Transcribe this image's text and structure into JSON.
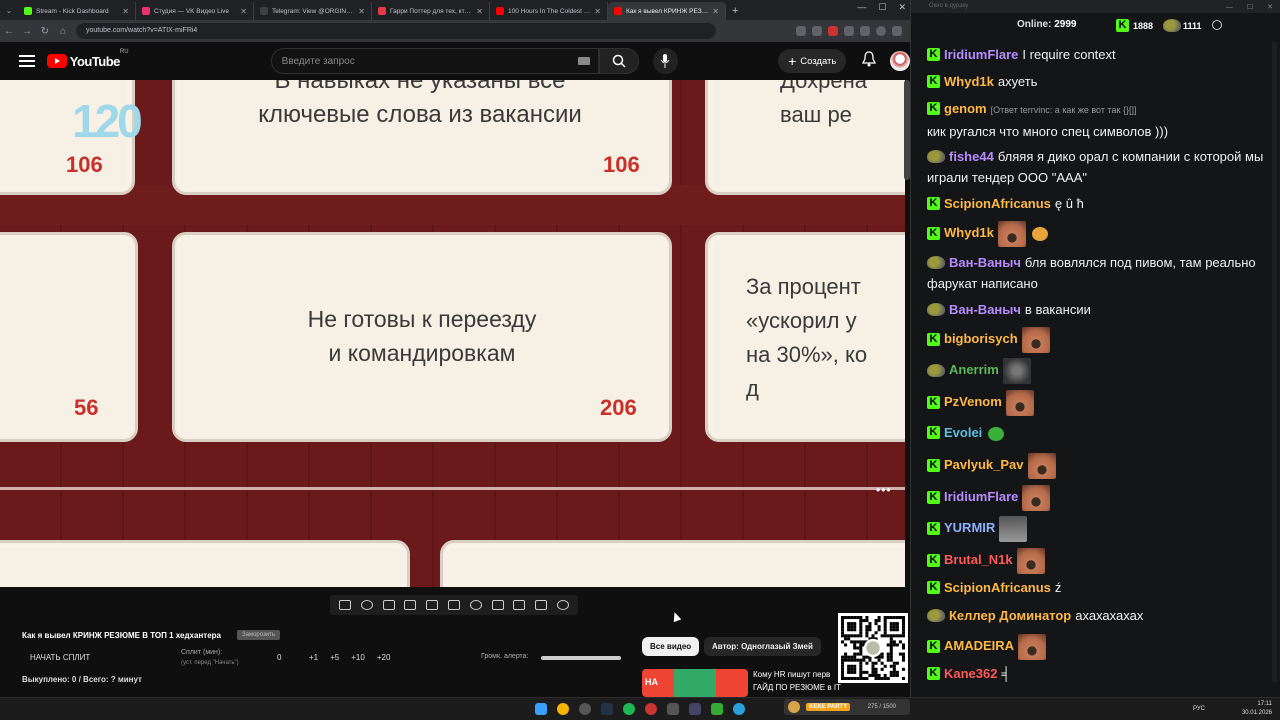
{
  "browser": {
    "tabs": [
      {
        "label": "Stream - Kick Dashboard",
        "color": "#53fc18"
      },
      {
        "label": "Студия — VK Видео Live",
        "color": "#e8326e"
      },
      {
        "label": "Telegram: View @ORGINALDA...",
        "color": "#3c4043"
      },
      {
        "label": "Гарри Поттер для тех, кто вы...",
        "color": "#e63946"
      },
      {
        "label": "100 Hours In The Coldest City",
        "color": "#ff0000"
      },
      {
        "label": "Как я вывел КРИНЖ РЕЗЮ...",
        "color": "#ff0000"
      }
    ],
    "active_tab": 5,
    "url": "youtube.com/watch?v=ATIX-miFRi4"
  },
  "youtube": {
    "logo_word": "YouTube",
    "country": "RU",
    "search_placeholder": "Введите запрос",
    "create_label": "Создать"
  },
  "video": {
    "timer": "120",
    "cards": [
      {
        "text": "В навыках не указаны все\nключевые слова из вакансии",
        "points": "106",
        "left_points": "106"
      },
      {
        "text": "Не готовы к переезду\nи командировкам",
        "points": "206",
        "left_points": "56"
      },
      {
        "text_right_top": "Дохрена\nваш ре",
        "text_right_mid": "За процент\n«ускорил у\nна 30%», ко\nд"
      }
    ]
  },
  "below": {
    "video_title": "Как я вывел КРИНЖ РЕЗЮМЕ В ТОП 1 хедхантера",
    "tag_button": "Заморозить",
    "split_button": "НАЧАТЬ СПЛИТ",
    "split_label": "Сплит (мин):",
    "split_hint": "(уст. перед \"Начать\")",
    "split_value": "0",
    "increments": [
      "+1",
      "+5",
      "+10",
      "+20"
    ],
    "bought": "Выкуплено: 0 / Всего: ? минут",
    "alert_label": "Громк. алерта:",
    "chip_all": "Все видео",
    "chip_author": "Автор: Одноглазый Змей",
    "rec_line1": "Кому HR пишут перв",
    "rec_line2": "ГАЙД ПО РЕЗЮМЕ в IT",
    "thumb_text": "НА"
  },
  "chat": {
    "window_title": "Окно в дураку",
    "online_label": "Online:",
    "online_count": "2999",
    "kick_count": "1888",
    "goblin_count": "1111",
    "messages": [
      {
        "user": "IridiumFlare",
        "color": "#b68cff",
        "badge": "kick",
        "text": "I require context"
      },
      {
        "user": "Whyd1k",
        "color": "#ffb946",
        "badge": "kick",
        "text": "ахуеть"
      },
      {
        "user": "genom",
        "color": "#ffb946",
        "badge": "kick",
        "reply": "[Ответ terrvinc: а как же вот так {}[]]",
        "text": "кик ругался что много спец символов )))"
      },
      {
        "user": "fishe44",
        "color": "#b68cff",
        "badge": "goblin",
        "text": "бляяя я дико орал с компании с которой мы играли тендер ООО \"ААА\""
      },
      {
        "user": "ScipionAfricanus",
        "color": "#ffb946",
        "badge": "kick",
        "text": "ę û ħ"
      },
      {
        "user": "Whyd1k",
        "color": "#ffb946",
        "badge": "kick",
        "text": "",
        "emote": "face",
        "extra": "fire"
      },
      {
        "user": "Ван-Ваныч",
        "color": "#b68cff",
        "badge": "goblin",
        "text": "бля вовлялся под пивом, там реально фарукат написано"
      },
      {
        "user": "Ван-Ваныч",
        "color": "#b68cff",
        "badge": "goblin",
        "text": "в вакансии"
      },
      {
        "user": "bigborisych",
        "color": "#ffb946",
        "badge": "kick",
        "text": "",
        "emote": "face"
      },
      {
        "user": "Anerrim",
        "color": "#5cb85c",
        "badge": "goblin",
        "text": "",
        "emote": "dark"
      },
      {
        "user": "PzVenom",
        "color": "#ffb946",
        "badge": "kick",
        "text": "",
        "emote": "face"
      },
      {
        "user": "Evolei",
        "color": "#5bc0de",
        "badge": "kick",
        "text": "",
        "extra": "green"
      },
      {
        "user": "Pavlyuk_Pav",
        "color": "#ffb946",
        "badge": "kick",
        "text": "",
        "emote": "face"
      },
      {
        "user": "IridiumFlare",
        "color": "#b68cff",
        "badge": "kick",
        "text": "",
        "emote": "face"
      },
      {
        "user": "YURMIR",
        "color": "#8fb0ff",
        "badge": "kick",
        "text": "",
        "emote": "bw"
      },
      {
        "user": "Brutal_N1k",
        "color": "#ff5a5a",
        "badge": "kick",
        "text": "",
        "emote": "face"
      },
      {
        "user": "ScipionAfricanus",
        "color": "#ffb946",
        "badge": "kick",
        "text": "ź"
      },
      {
        "user": "Келлер Доминатор",
        "color": "#ffb946",
        "badge": "goblin",
        "text": "ахахахахах"
      },
      {
        "user": "AMADEIRA",
        "color": "#ffb946",
        "badge": "kick",
        "text": "",
        "emote": "face"
      },
      {
        "user": "Kane362",
        "color": "#ff5a5a",
        "badge": "kick",
        "text": "╡"
      }
    ]
  },
  "taskbar": {
    "kickparty_label": "KEKE PARTY",
    "kickparty_count": "275 / 1500",
    "lang": "РУС",
    "time": "17:11",
    "date": "30.01.2026"
  }
}
